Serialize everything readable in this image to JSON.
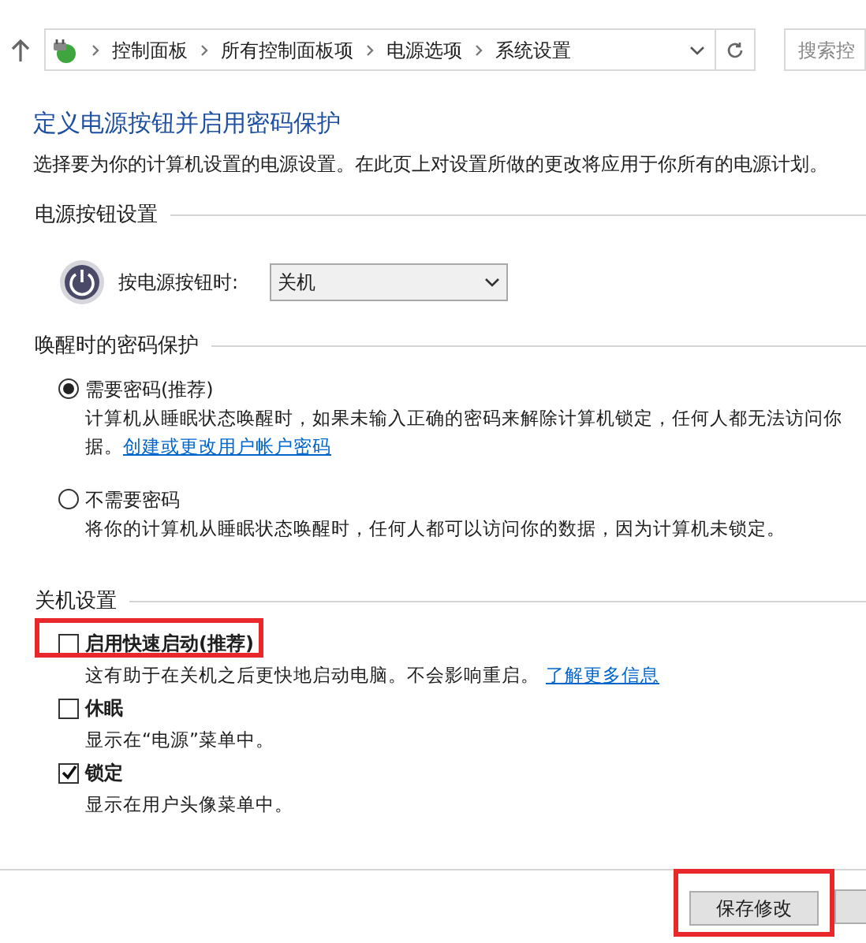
{
  "address_bar": {
    "breadcrumbs": [
      "控制面板",
      "所有控制面板项",
      "电源选项",
      "系统设置"
    ],
    "search": {
      "placeholder": "搜索控"
    }
  },
  "title": "定义电源按钮并启用密码保护",
  "subtitle": "选择要为你的计算机设置的电源设置。在此页上对设置所做的更改将应用于你所有的电源计划。",
  "power_button_section": {
    "heading": "电源按钮设置",
    "label": "按电源按钮时:",
    "value": "关机"
  },
  "password_section": {
    "heading": "唤醒时的密码保护",
    "options": [
      {
        "label": "需要密码(推荐)",
        "selected": true,
        "description": [
          "计算机从睡眠状态唤醒时，如果未输入正确的密码来解除计算机锁定，任何人都无法访问你",
          "据。"
        ],
        "link": "创建或更改用户帐户密码"
      },
      {
        "label": "不需要密码",
        "selected": false,
        "description": [
          "将你的计算机从睡眠状态唤醒时，任何人都可以访问你的数据，因为计算机未锁定。"
        ]
      }
    ]
  },
  "shutdown_section": {
    "heading": "关机设置",
    "items": [
      {
        "label": "启用快速启动(推荐)",
        "checked": false,
        "highlighted": true,
        "description": "这有助于在关机之后更快地启动电脑。不会影响重启。",
        "link": "了解更多信息"
      },
      {
        "label": "休眠",
        "checked": false,
        "highlighted": false,
        "description": "显示在“电源”菜单中。"
      },
      {
        "label": "锁定",
        "checked": true,
        "highlighted": false,
        "description": "显示在用户头像菜单中。"
      }
    ]
  },
  "save_button": {
    "label": "保存修改",
    "highlighted": true
  }
}
